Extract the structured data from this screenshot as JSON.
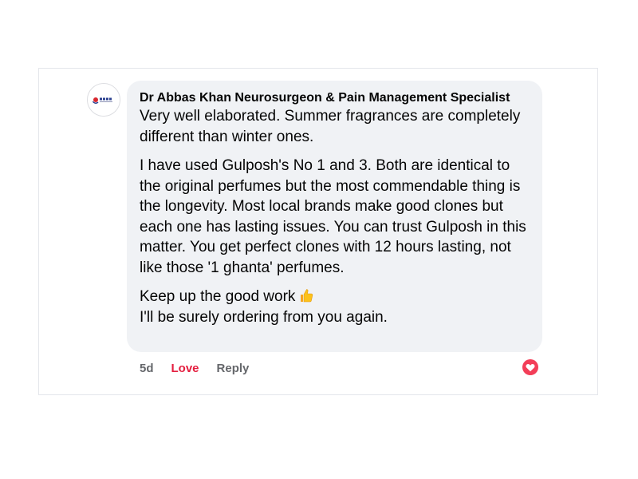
{
  "comment": {
    "author": "Dr Abbas Khan Neurosurgeon & Pain Management Specialist",
    "paragraphs": [
      "Very well elaborated. Summer fragrances are completely different than winter ones.",
      "I have used Gulposh's No 1 and 3. Both are identical to the original perfumes but the most commendable thing is the longevity. Most local brands make good clones but each one has lasting issues. You can trust Gulposh in this matter. You get perfect clones with 12 hours lasting, not like those '1 ghanta' perfumes."
    ],
    "closing_line_1": "Keep up the good work",
    "closing_emoji": "thumbs-up-emoji",
    "closing_line_2": "I'll be surely ordering from you again."
  },
  "actions": {
    "timestamp": "5d",
    "love_label": "Love",
    "reply_label": "Reply"
  },
  "reaction": {
    "icon": "love-reaction-icon",
    "color": "#f33e58"
  },
  "colors": {
    "bubble": "#f0f2f5",
    "text": "#050505",
    "muted": "#65676b",
    "love": "#e41e3f"
  }
}
